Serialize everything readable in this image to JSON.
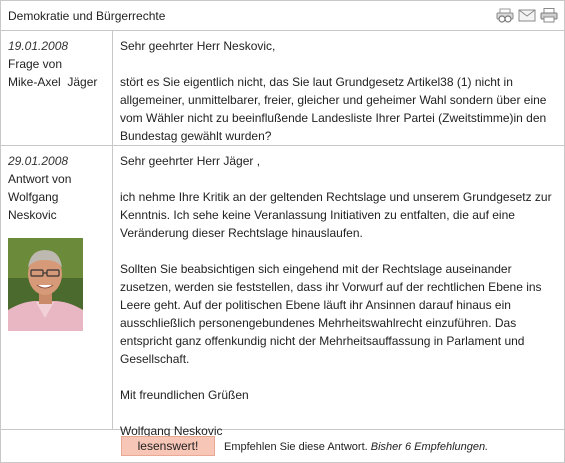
{
  "header": {
    "title": "Demokratie und Bürgerrechte",
    "icons": [
      "print-preview-icon",
      "mail-icon",
      "print-icon"
    ]
  },
  "question": {
    "date": "19.01.2008",
    "label": "Frage von",
    "author": "Mike-Axel  Jäger",
    "salutation": "Sehr geehrter Herr Neskovic,",
    "body": "stört es Sie eigentlich nicht, das Sie laut Grundgesetz Artikel38 (1) nicht in allgemeiner, unmittelbarer, freier, gleicher und geheimer Wahl sondern über eine vom Wähler nicht zu beeinflußende Landesliste Ihrer Partei (Zweitstimme)in den Bundestag gewählt wurden?"
  },
  "answer": {
    "date": "29.01.2008",
    "label": "Antwort von",
    "author_first": "Wolfgang",
    "author_last": "Neskovic",
    "salutation": "Sehr geehrter Herr Jäger ,",
    "paragraph1": "ich nehme Ihre Kritik an der geltenden Rechtslage und unserem Grundgesetz zur Kenntnis. Ich sehe keine Veranlassung Initiativen zu entfalten, die auf eine Veränderung dieser Rechtslage hinauslaufen.",
    "paragraph2": "Sollten Sie beabsichtigen sich eingehend mit der Rechtslage auseinander zusetzen, werden sie feststellen, dass ihr Vorwurf auf der rechtlichen Ebene ins Leere geht. Auf der politischen Ebene läuft ihr Ansinnen darauf hinaus ein ausschließlich personengebundenes Mehrheitswahlrecht einzuführen. Das entspricht ganz offenkundig nicht der Mehrheitsauffassung in Parlament und Gesellschaft.",
    "closing": "Mit freundlichen Grüßen",
    "signature": "Wolfgang Neskovic"
  },
  "footer": {
    "button_label": "lesenswert!",
    "recommend_text": "Empfehlen Sie diese Antwort.",
    "recommend_count": "Bisher 6 Empfehlungen.",
    "button_color": "#f7c6b6"
  }
}
